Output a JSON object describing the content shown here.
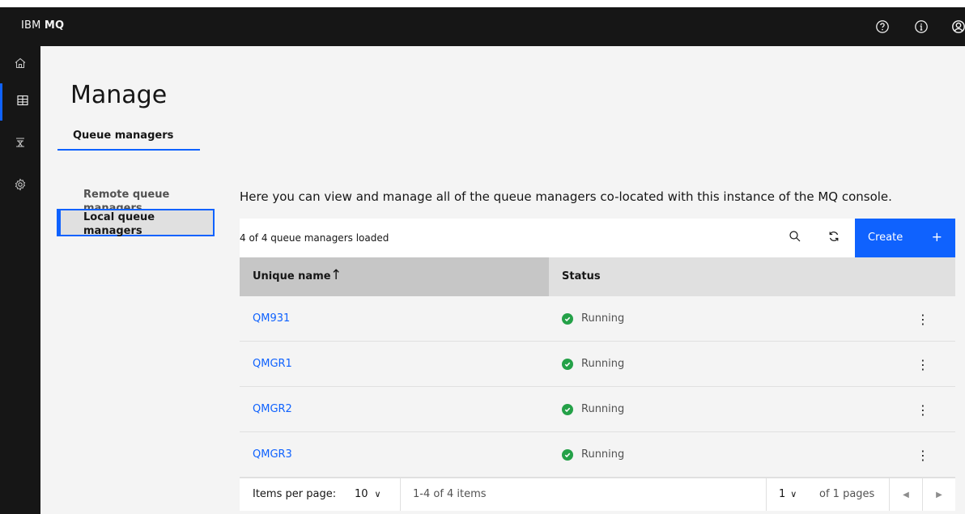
{
  "header": {
    "brand_prefix": "IBM",
    "brand_product": "MQ",
    "icons": [
      "help-icon",
      "info-icon",
      "user-icon"
    ]
  },
  "siderail": {
    "items": [
      {
        "name": "home-icon"
      },
      {
        "name": "manage-icon",
        "active": true
      },
      {
        "name": "topology-icon"
      },
      {
        "name": "settings-icon"
      }
    ]
  },
  "page": {
    "title": "Manage",
    "tab": "Queue managers"
  },
  "subnav": {
    "remote": "Remote queue managers",
    "local": "Local queue managers"
  },
  "main": {
    "description": "Here you can view and manage all of the queue managers co-located with this instance of the MQ console.",
    "loaded": "4 of 4 queue managers loaded",
    "create_label": "Create",
    "create_icon": "+"
  },
  "table": {
    "col_name": "Unique name",
    "sort_icon": "↑",
    "col_status": "Status",
    "rows": [
      {
        "name": "QM931",
        "status": "Running"
      },
      {
        "name": "QMGR1",
        "status": "Running"
      },
      {
        "name": "QMGR2",
        "status": "Running"
      },
      {
        "name": "QMGR3",
        "status": "Running"
      }
    ]
  },
  "pagination": {
    "items_per_page_label": "Items per page:",
    "page_size": "10",
    "range": "1-4 of 4 items",
    "current_page": "1",
    "total_pages_label": "of 1 pages"
  },
  "colors": {
    "accent": "#0f62fe",
    "success": "#24a148",
    "header_bg": "#161616"
  }
}
